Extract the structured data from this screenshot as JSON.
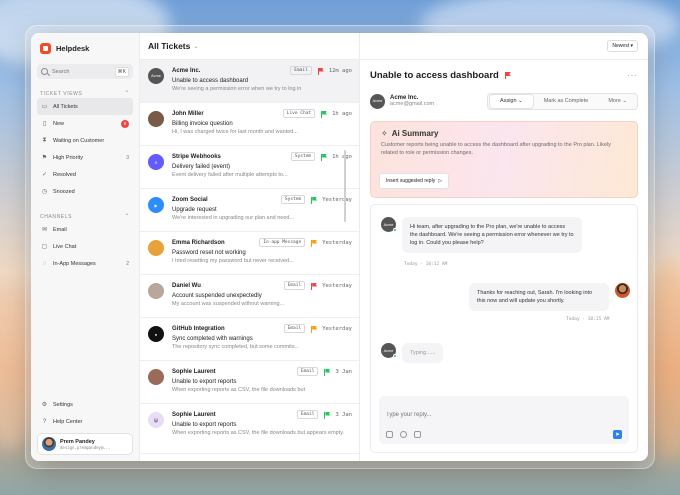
{
  "app": {
    "name": "Helpdesk"
  },
  "sidebar": {
    "search_placeholder": "Search",
    "search_shortcut": "⌘K",
    "ticket_views_title": "TICKET VIEWS",
    "views": [
      {
        "label": "All Tickets",
        "icon": "inbox-icon",
        "badge": ""
      },
      {
        "label": "New",
        "icon": "file-icon",
        "badge": "6"
      },
      {
        "label": "Waiting on Customer",
        "icon": "hourglass-icon",
        "badge": ""
      },
      {
        "label": "High Priority",
        "icon": "flag-icon",
        "badge": "3"
      },
      {
        "label": "Resolved",
        "icon": "check-icon",
        "badge": ""
      },
      {
        "label": "Snoozed",
        "icon": "clock-icon",
        "badge": ""
      }
    ],
    "channels_title": "CHANNELS",
    "channels": [
      {
        "label": "Email",
        "icon": "mail-icon",
        "badge": ""
      },
      {
        "label": "Live Chat",
        "icon": "chat-icon",
        "badge": ""
      },
      {
        "label": "In-App Messages",
        "icon": "message-icon",
        "badge": "2"
      }
    ],
    "settings_label": "Settings",
    "help_label": "Help Center",
    "user": {
      "name": "Prem Pandey",
      "email": "design.prempandey@..."
    }
  },
  "list": {
    "title": "All Tickets",
    "tickets": [
      {
        "name": "Acme Inc.",
        "avatar_text": "Acme",
        "avatar_color": "#555555",
        "source": "Email",
        "flag_color": "#ef4444",
        "time": "12m ago",
        "subject": "Unable to access dashboard",
        "preview": "We're seeing a permission error when we try to log in",
        "active": true
      },
      {
        "name": "John Miller",
        "avatar_text": "",
        "avatar_color": "#7a5a48",
        "source": "Live Chat",
        "flag_color": "#22c55e",
        "time": "1h ago",
        "subject": "Billing invoice question",
        "preview": "Hi, I was charged twice for last month and wanted...",
        "active": false
      },
      {
        "name": "Stripe Webhooks",
        "avatar_text": "S",
        "avatar_color": "#635bff",
        "source": "System",
        "flag_color": "#22c55e",
        "time": "1h ago",
        "subject": "Delivery failed (event)",
        "preview": "Event delivery failed after multiple attempts to...",
        "active": false
      },
      {
        "name": "Zoom Social",
        "avatar_text": "▶",
        "avatar_color": "#2d8cff",
        "source": "System",
        "flag_color": "#22c55e",
        "time": "Yesterday",
        "subject": "Upgrade request",
        "preview": "We're interested in upgrading our plan and need...",
        "active": false
      },
      {
        "name": "Emma Richardson",
        "avatar_text": "",
        "avatar_color": "#e8a23a",
        "source": "In-app Message",
        "flag_color": "#f59e0b",
        "time": "Yesterday",
        "subject": "Password reset not working",
        "preview": "I tried resetting my password but never received...",
        "active": false
      },
      {
        "name": "Daniel Wu",
        "avatar_text": "",
        "avatar_color": "#b9a79c",
        "source": "Email",
        "flag_color": "#ef4444",
        "time": "Yesterday",
        "subject": "Account suspended unexpectedly",
        "preview": "My account was suspended without warning...",
        "active": false
      },
      {
        "name": "GitHub Integration",
        "avatar_text": "●",
        "avatar_color": "#111111",
        "source": "Email",
        "flag_color": "#f59e0b",
        "time": "Yesterday",
        "subject": "Sync completed with warnings",
        "preview": "The repository sync completed, but some commits...",
        "active": false
      },
      {
        "name": "Sophie Laurent",
        "avatar_text": "",
        "avatar_color": "#9a6b5a",
        "source": "Email",
        "flag_color": "#22c55e",
        "time": "3 Jan",
        "subject": "Unable to export reports",
        "preview": "When exporting reports as CSV, the file downloads but",
        "active": false
      },
      {
        "name": "Sophie Laurent",
        "avatar_text": "😺",
        "avatar_color": "#e9dcf7",
        "source": "Email",
        "flag_color": "#22c55e",
        "time": "3 Jan",
        "subject": "Unable to export reports",
        "preview": "When exporting reports as CSV, the file downloads but appears empty.",
        "active": false
      }
    ]
  },
  "detail": {
    "sort_label": "Newest",
    "title": "Unable to access dashboard",
    "contact": {
      "name": "Acme Inc.",
      "email": "acme@gmail.com",
      "avatar_text": "Acme"
    },
    "actions": {
      "assign": "Assign",
      "complete": "Mark as Complete",
      "more": "More"
    },
    "ai": {
      "title": "Ai Summary",
      "text": "Customer reports being unable to access the dashboard after upgrading to the Pro plan. Likely related to role or permission changes.",
      "button": "Insert suggested reply"
    },
    "messages": [
      {
        "from": "Acme",
        "text": "Hi team, after upgrading to the Pro plan, we're unable to access the dashboard. We're seeing a permission error whenever we try to log in. Could you please help?",
        "time": "Today · 10:12 AM"
      },
      {
        "from": "agent",
        "text": "Thanks for reaching out, Sarah. I'm looking into this now and will update you shortly.",
        "time": "Today · 10:15 AM"
      }
    ],
    "typing": "Typing......",
    "compose_placeholder": "Type your reply..."
  }
}
